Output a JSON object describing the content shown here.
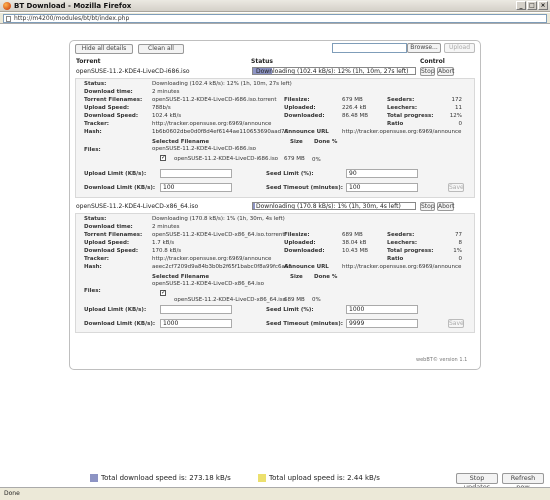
{
  "window": {
    "title": "BT Download - Mozilla Firefox"
  },
  "url": "http://m4200/modules/bt/bt/index.php",
  "toolbar": {
    "hide_details": "Hide all details",
    "clean_all": "Clean all",
    "browse": "Browse...",
    "upload": "Upload"
  },
  "headers": {
    "torrent": "Torrent",
    "status": "Status",
    "control": "Control"
  },
  "controls": {
    "stop": "Stop",
    "abort": "Abort",
    "save": "Save"
  },
  "labels": {
    "status": "Status:",
    "download_time": "Download time:",
    "torrent_filenames": "Torrent Filenames:",
    "upload_speed": "Upload Speed:",
    "download_speed": "Download Speed:",
    "tracker": "Tracker:",
    "hash": "Hash:",
    "filesize": "Filesize:",
    "uploaded": "Uploaded:",
    "downloaded": "Downloaded:",
    "announce_url": "Announce URL",
    "seeders": "Seeders:",
    "leechers": "Leechers:",
    "total_progress": "Total progress:",
    "ratio": "Ratio",
    "selected_filename": "Selected Filename",
    "size": "Size",
    "done_pct": "Done %",
    "files": "Files:",
    "upload_limit": "Upload Limit (KB/s):",
    "download_limit": "Download Limit (KB/s):",
    "seed_limit": "Seed Limit (%):",
    "seed_timeout": "Seed Timeout (minutes):"
  },
  "torrents": [
    {
      "name": "openSUSE-11.2-KDE4-LiveCD-i686.iso",
      "status_bar": "Downloading (102.4 kB/s): 12% (1h, 10m, 27s left)",
      "progress": 12,
      "details": {
        "status": "Downloading (102.4 kB/s): 12% (1h, 10m, 27s left)",
        "download_time": "2 minutes",
        "torrent_filenames": "openSUSE-11.2-KDE4-LiveCD-i686.iso.torrent",
        "upload_speed": "788b/s",
        "download_speed": "102.4 kB/s",
        "tracker": "http://tracker.opensuse.org:6969/announce",
        "hash": "1b6b0602dbe0d0f8d4ef6144ae110653690aad7d",
        "filesize": "679 MB",
        "uploaded": "226.4 kB",
        "downloaded": "86.48 MB",
        "announce_url": "http://tracker.opensuse.org:6969/announce",
        "seeders": "172",
        "leechers": "11",
        "total_progress": "12%",
        "ratio": "0",
        "file_name": "openSUSE-11.2-KDE4-LiveCD-i686.iso",
        "file_size": "679 MB",
        "file_done": "0%",
        "upload_limit": "",
        "download_limit": "100",
        "seed_limit": "90",
        "seed_timeout": "100"
      }
    },
    {
      "name": "openSUSE-11.2-KDE4-LiveCD-x86_64.iso",
      "status_bar": "Downloading (170.8 kB/s): 1% (1h, 30m, 4s left)",
      "progress": 1,
      "details": {
        "status": "Downloading (170.8 kB/s): 1% (1h, 30m, 4s left)",
        "download_time": "2 minutes",
        "torrent_filenames": "openSUSE-11.2-KDE4-LiveCD-x86_64.iso.torrent",
        "upload_speed": "1.7 kB/s",
        "download_speed": "170.8 kB/s",
        "tracker": "http://tracker.opensuse.org:6969/announce",
        "hash": "aeec2cf7209d9a84b3b0b2f65f1babc0f8a99fc6a65",
        "filesize": "689 MB",
        "uploaded": "38.04 kB",
        "downloaded": "10.43 MB",
        "announce_url": "http://tracker.opensuse.org:6969/announce",
        "seeders": "77",
        "leechers": "8",
        "total_progress": "1%",
        "ratio": "0",
        "file_name": "openSUSE-11.2-KDE4-LiveCD-x86_64.iso",
        "file_size": "689 MB",
        "file_done": "0%",
        "upload_limit": "",
        "download_limit": "1000",
        "seed_limit": "1000",
        "seed_timeout": "9999"
      }
    }
  ],
  "version": "webBT© version 1.1",
  "footer": {
    "download_speed": "Total download speed is: 273.18 kB/s",
    "upload_speed": "Total upload speed is: 2.44 kB/s",
    "stop_updates": "Stop updates",
    "refresh_now": "Refresh now",
    "download_color": "#8d94c4",
    "upload_color": "#ece06e"
  },
  "statusbar": "Done"
}
